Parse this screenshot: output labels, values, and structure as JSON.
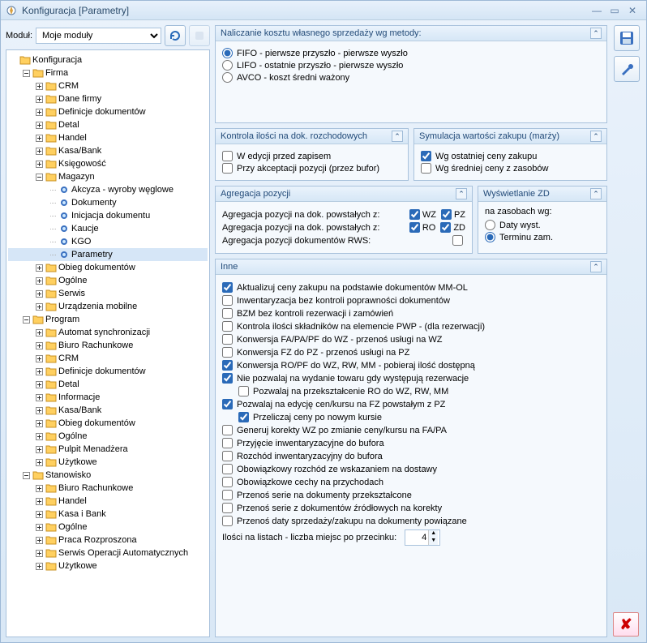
{
  "window": {
    "title": "Konfiguracja [Parametry]"
  },
  "module": {
    "label": "Moduł:",
    "selected": "Moje moduły"
  },
  "tree": [
    {
      "d": 0,
      "exp": "",
      "t": "f",
      "label": "Konfiguracja"
    },
    {
      "d": 1,
      "exp": "−",
      "t": "f",
      "label": "Firma"
    },
    {
      "d": 2,
      "exp": "+",
      "t": "f",
      "label": "CRM"
    },
    {
      "d": 2,
      "exp": "+",
      "t": "f",
      "label": "Dane firmy"
    },
    {
      "d": 2,
      "exp": "+",
      "t": "f",
      "label": "Definicje dokumentów"
    },
    {
      "d": 2,
      "exp": "+",
      "t": "f",
      "label": "Detal"
    },
    {
      "d": 2,
      "exp": "+",
      "t": "f",
      "label": "Handel"
    },
    {
      "d": 2,
      "exp": "+",
      "t": "f",
      "label": "Kasa/Bank"
    },
    {
      "d": 2,
      "exp": "+",
      "t": "f",
      "label": "Księgowość"
    },
    {
      "d": 2,
      "exp": "−",
      "t": "f",
      "label": "Magazyn"
    },
    {
      "d": 3,
      "exp": "",
      "t": "b",
      "label": "Akcyza - wyroby węglowe"
    },
    {
      "d": 3,
      "exp": "",
      "t": "b",
      "label": "Dokumenty"
    },
    {
      "d": 3,
      "exp": "",
      "t": "b",
      "label": "Inicjacja dokumentu"
    },
    {
      "d": 3,
      "exp": "",
      "t": "b",
      "label": "Kaucje"
    },
    {
      "d": 3,
      "exp": "",
      "t": "b",
      "label": "KGO"
    },
    {
      "d": 3,
      "exp": "",
      "t": "b",
      "label": "Parametry",
      "sel": true
    },
    {
      "d": 2,
      "exp": "+",
      "t": "f",
      "label": "Obieg dokumentów"
    },
    {
      "d": 2,
      "exp": "+",
      "t": "f",
      "label": "Ogólne"
    },
    {
      "d": 2,
      "exp": "+",
      "t": "f",
      "label": "Serwis"
    },
    {
      "d": 2,
      "exp": "+",
      "t": "f",
      "label": "Urządzenia mobilne"
    },
    {
      "d": 1,
      "exp": "−",
      "t": "f",
      "label": "Program"
    },
    {
      "d": 2,
      "exp": "+",
      "t": "f",
      "label": "Automat synchronizacji"
    },
    {
      "d": 2,
      "exp": "+",
      "t": "f",
      "label": "Biuro Rachunkowe"
    },
    {
      "d": 2,
      "exp": "+",
      "t": "f",
      "label": "CRM"
    },
    {
      "d": 2,
      "exp": "+",
      "t": "f",
      "label": "Definicje dokumentów"
    },
    {
      "d": 2,
      "exp": "+",
      "t": "f",
      "label": "Detal"
    },
    {
      "d": 2,
      "exp": "+",
      "t": "f",
      "label": "Informacje"
    },
    {
      "d": 2,
      "exp": "+",
      "t": "f",
      "label": "Kasa/Bank"
    },
    {
      "d": 2,
      "exp": "+",
      "t": "f",
      "label": "Obieg dokumentów"
    },
    {
      "d": 2,
      "exp": "+",
      "t": "f",
      "label": "Ogólne"
    },
    {
      "d": 2,
      "exp": "+",
      "t": "f",
      "label": "Pulpit Menadżera"
    },
    {
      "d": 2,
      "exp": "+",
      "t": "f",
      "label": "Użytkowe"
    },
    {
      "d": 1,
      "exp": "−",
      "t": "f",
      "label": "Stanowisko"
    },
    {
      "d": 2,
      "exp": "+",
      "t": "f",
      "label": "Biuro Rachunkowe"
    },
    {
      "d": 2,
      "exp": "+",
      "t": "f",
      "label": "Handel"
    },
    {
      "d": 2,
      "exp": "+",
      "t": "f",
      "label": "Kasa i Bank"
    },
    {
      "d": 2,
      "exp": "+",
      "t": "f",
      "label": "Ogólne"
    },
    {
      "d": 2,
      "exp": "+",
      "t": "f",
      "label": "Praca Rozproszona"
    },
    {
      "d": 2,
      "exp": "+",
      "t": "f",
      "label": "Serwis Operacji Automatycznych"
    },
    {
      "d": 2,
      "exp": "+",
      "t": "f",
      "label": "Użytkowe"
    }
  ],
  "costMethod": {
    "title": "Naliczanie kosztu własnego sprzedaży wg metody:",
    "options": [
      {
        "label": "FIFO - pierwsze przyszło - pierwsze wyszło",
        "checked": true
      },
      {
        "label": "LIFO - ostatnie przyszło - pierwsze wyszło",
        "checked": false
      },
      {
        "label": "AVCO - koszt średni ważony",
        "checked": false
      }
    ]
  },
  "kontrola": {
    "title": "Kontrola ilości na dok. rozchodowych",
    "items": [
      {
        "label": "W edycji przed zapisem",
        "checked": false
      },
      {
        "label": "Przy akceptacji pozycji (przez bufor)",
        "checked": false
      }
    ]
  },
  "symulacja": {
    "title": "Symulacja wartości zakupu (marży)",
    "items": [
      {
        "label": "Wg ostatniej ceny zakupu",
        "checked": true
      },
      {
        "label": "Wg średniej ceny z zasobów",
        "checked": false
      }
    ]
  },
  "agregacja": {
    "title": "Agregacja pozycji",
    "rows": [
      {
        "label": "Agregacja pozycji na dok. powstałych z:",
        "c1": {
          "lbl": "WZ",
          "checked": true
        },
        "c2": {
          "lbl": "PZ",
          "checked": true
        }
      },
      {
        "label": "Agregacja pozycji na dok. powstałych z:",
        "c1": {
          "lbl": "RO",
          "checked": true
        },
        "c2": {
          "lbl": "ZD",
          "checked": true
        }
      },
      {
        "label": "Agregacja pozycji dokumentów RWS:",
        "c1": {
          "lbl": "",
          "checked": false,
          "hidden": false
        },
        "c2": null
      }
    ]
  },
  "wyswietlanie": {
    "title": "Wyświetlanie ZD",
    "sub": "na zasobach wg:",
    "options": [
      {
        "label": "Daty wyst.",
        "checked": false
      },
      {
        "label": "Terminu zam.",
        "checked": true
      }
    ]
  },
  "inne": {
    "title": "Inne",
    "items": [
      {
        "label": "Aktualizuj ceny zakupu na podstawie dokumentów MM-OL",
        "checked": true,
        "ind": 0
      },
      {
        "label": "Inwentaryzacja bez kontroli poprawności dokumentów",
        "checked": false,
        "ind": 0
      },
      {
        "label": "BZM bez kontroli rezerwacji i zamówień",
        "checked": false,
        "ind": 0
      },
      {
        "label": "Kontrola ilości składników na elemencie PWP - (dla rezerwacji)",
        "checked": false,
        "ind": 0
      },
      {
        "label": "Konwersja FA/PA/PF do WZ - przenoś usługi na WZ",
        "checked": false,
        "ind": 0
      },
      {
        "label": "Konwersja FZ do PZ - przenoś usługi na PZ",
        "checked": false,
        "ind": 0
      },
      {
        "label": "Konwersja RO/PF do WZ, RW, MM - pobieraj ilość dostępną",
        "checked": true,
        "ind": 0
      },
      {
        "label": "Nie pozwalaj na wydanie towaru gdy występują rezerwacje",
        "checked": true,
        "ind": 0
      },
      {
        "label": "Pozwalaj na przekształcenie RO do WZ, RW, MM",
        "checked": false,
        "ind": 1
      },
      {
        "label": "Pozwalaj na edycję cen/kursu na FZ powstałym z PZ",
        "checked": true,
        "ind": 0
      },
      {
        "label": "Przeliczaj ceny po nowym kursie",
        "checked": true,
        "ind": 1
      },
      {
        "label": "Generuj korekty WZ po zmianie ceny/kursu na FA/PA",
        "checked": false,
        "ind": 0
      },
      {
        "label": "Przyjęcie inwentaryzacyjne do bufora",
        "checked": false,
        "ind": 0
      },
      {
        "label": "Rozchód inwentaryzacyjny do bufora",
        "checked": false,
        "ind": 0
      },
      {
        "label": "Obowiązkowy rozchód ze wskazaniem na dostawy",
        "checked": false,
        "ind": 0
      },
      {
        "label": "Obowiązkowe cechy na przychodach",
        "checked": false,
        "ind": 0
      },
      {
        "label": "Przenoś serie na dokumenty przekształcone",
        "checked": false,
        "ind": 0
      },
      {
        "label": "Przenoś serie z dokumentów źródłowych na korekty",
        "checked": false,
        "ind": 0
      },
      {
        "label": "Przenoś daty sprzedaży/zakupu na dokumenty powiązane",
        "checked": false,
        "ind": 0
      }
    ],
    "ilosci": {
      "label": "Ilości na listach - liczba miejsc po przecinku:",
      "value": "4"
    }
  }
}
